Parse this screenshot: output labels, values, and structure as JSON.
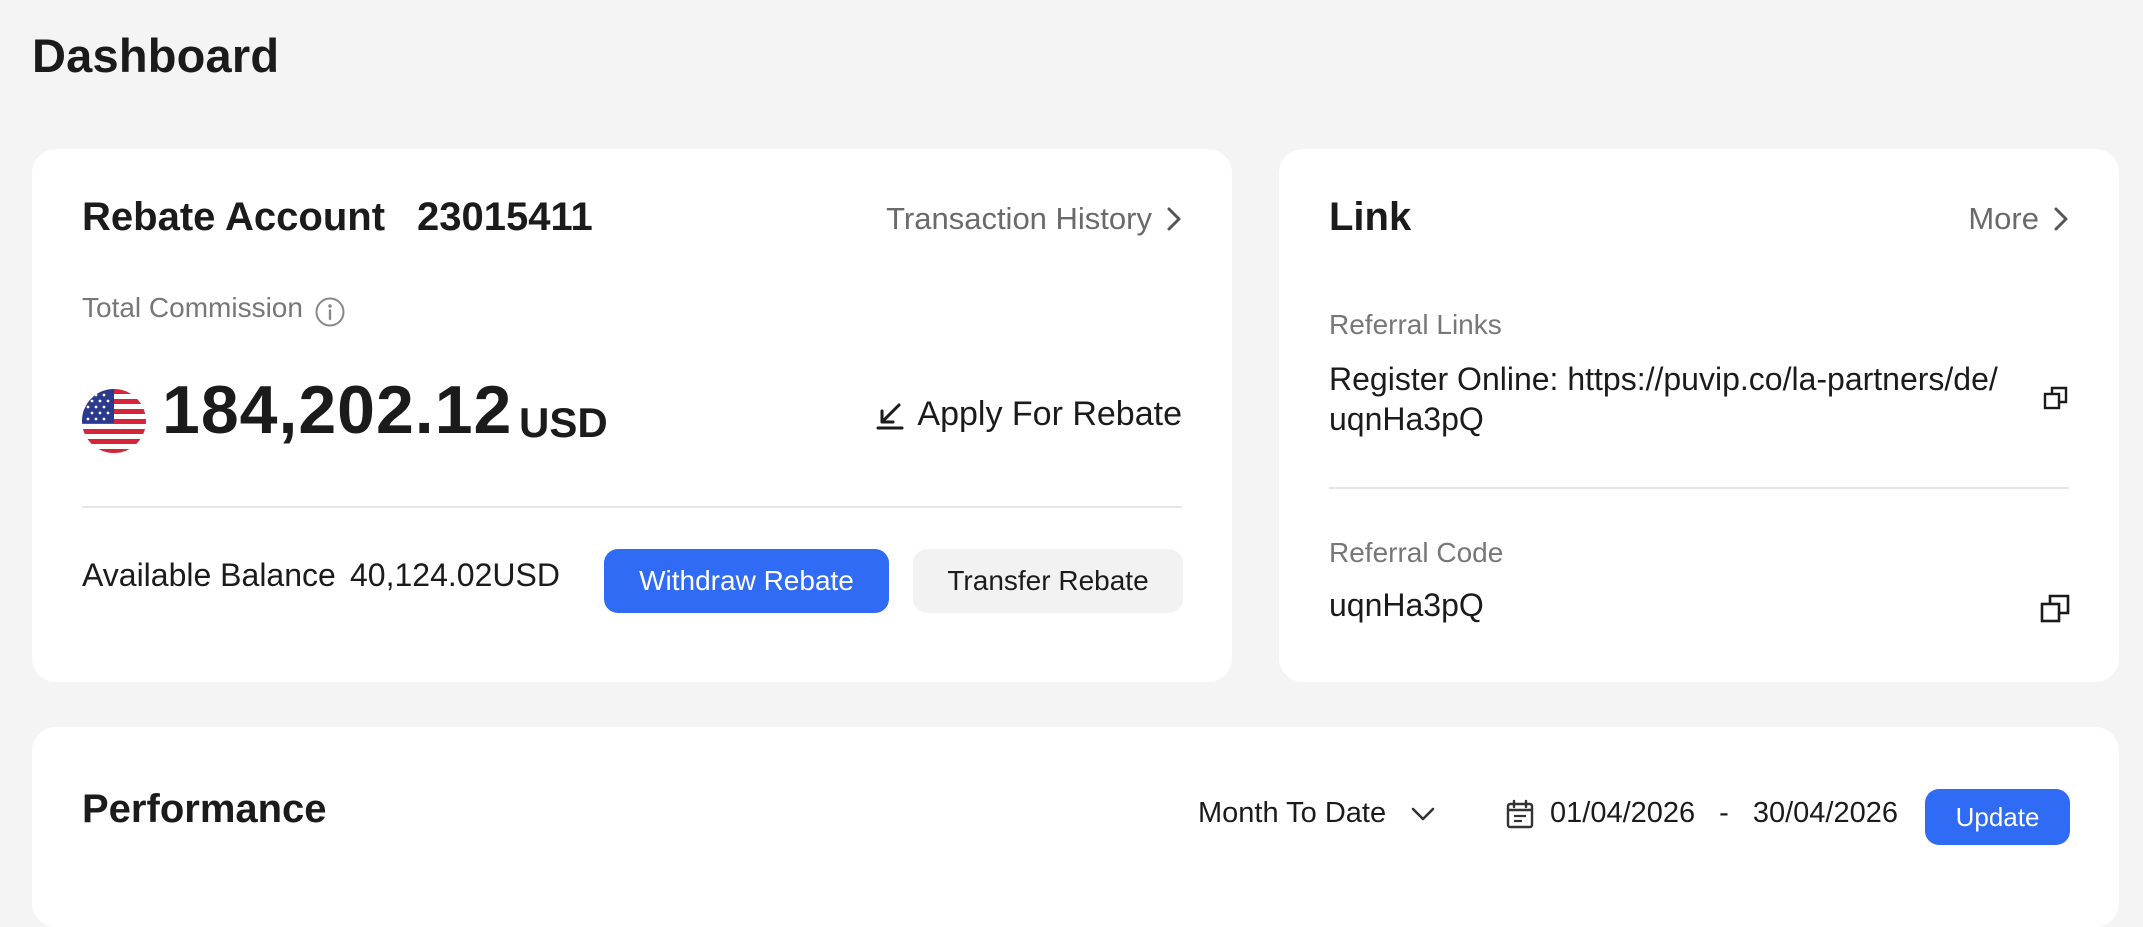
{
  "page": {
    "title": "Dashboard"
  },
  "rebate_account": {
    "title": "Rebate Account",
    "account_number": "23015411",
    "transaction_history_label": "Transaction History",
    "total_commission_label": "Total Commission",
    "total_commission_amount": "184,202.12",
    "currency": "USD",
    "flag_icon": "us-flag-icon",
    "apply_rebate_label": "Apply For Rebate",
    "available_balance_label": "Available Balance",
    "available_balance_value": "40,124.02USD",
    "withdraw_label": "Withdraw Rebate",
    "transfer_label": "Transfer Rebate"
  },
  "link": {
    "title": "Link",
    "more_label": "More",
    "referral_links_label": "Referral Links",
    "register_online_text": "Register Online: https://puvip.co/la-partners/de/uqnHa3pQ",
    "referral_code_label": "Referral Code",
    "referral_code_value": "uqnHa3pQ"
  },
  "performance": {
    "title": "Performance",
    "period_label": "Month To Date",
    "date_from": "01/04/2026",
    "date_separator": "-",
    "date_to": "30/04/2026",
    "update_label": "Update"
  },
  "colors": {
    "primary": "#2f6bf5",
    "background": "#f4f4f4",
    "card": "#ffffff",
    "muted_text": "#777777"
  }
}
